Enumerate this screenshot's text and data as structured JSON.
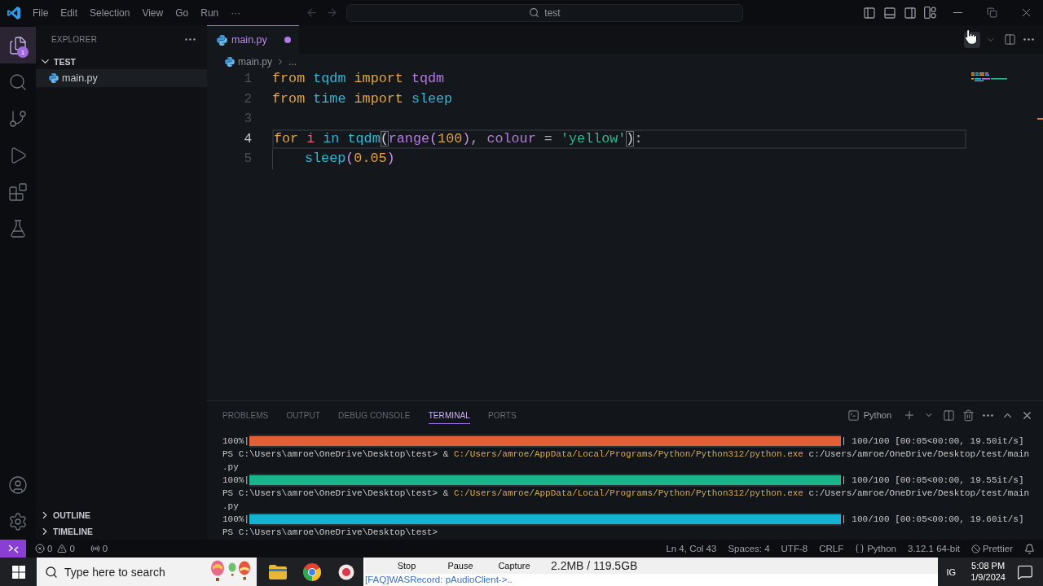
{
  "title_bar": {
    "menu": [
      "File",
      "Edit",
      "Selection",
      "View",
      "Go",
      "Run",
      "···"
    ],
    "command_center": "test"
  },
  "activity_bar": {
    "items": [
      {
        "kind": "explorer",
        "selected": true,
        "badge": "1"
      },
      {
        "kind": "search",
        "selected": false
      },
      {
        "kind": "source-control",
        "selected": false
      },
      {
        "kind": "run",
        "selected": false
      },
      {
        "kind": "extensions",
        "selected": false
      },
      {
        "kind": "testing",
        "selected": false
      }
    ],
    "bottom": [
      {
        "kind": "account"
      },
      {
        "kind": "settings"
      }
    ]
  },
  "sidebar": {
    "title": "EXPLORER",
    "folder": {
      "name": "TEST",
      "expanded": true,
      "children": [
        {
          "name": "main.py",
          "selected": true
        }
      ]
    },
    "sections": [
      {
        "name": "OUTLINE",
        "expanded": false
      },
      {
        "name": "TIMELINE",
        "expanded": false
      }
    ]
  },
  "editor": {
    "tabs": [
      {
        "label": "main.py",
        "selected": true,
        "modified": true
      }
    ],
    "breadcrumb": [
      "main.py",
      "..."
    ],
    "lines": [
      {
        "number": "1",
        "current": false,
        "tokens": [
          {
            "kind": "keyword",
            "text": "from"
          },
          {
            "kind": "module",
            "text": " tqdm"
          },
          {
            "kind": "keyword",
            "text": " import"
          },
          {
            "kind": "name",
            "text": " tqdm"
          }
        ]
      },
      {
        "number": "2",
        "current": false,
        "tokens": [
          {
            "kind": "keyword",
            "text": "from"
          },
          {
            "kind": "module",
            "text": " time"
          },
          {
            "kind": "keyword",
            "text": " import"
          },
          {
            "kind": "function",
            "text": " sleep"
          }
        ]
      },
      {
        "number": "3",
        "current": false
      },
      {
        "number": "4",
        "current": true,
        "tokens": [
          {
            "kind": "keyword",
            "text": "for"
          },
          {
            "kind": "variable",
            "text": " i"
          },
          {
            "kind": "operator",
            "text": " in"
          },
          {
            "kind": "function",
            "text": " tqdm"
          },
          {
            "kind": "bracket-match",
            "text": "("
          },
          {
            "kind": "builtin",
            "text": "range"
          },
          {
            "kind": "paren",
            "text": "("
          },
          {
            "kind": "number",
            "text": "100"
          },
          {
            "kind": "paren",
            "text": ")"
          },
          {
            "kind": "punct",
            "text": ","
          },
          {
            "kind": "param",
            "text": " colour"
          },
          {
            "kind": "punct",
            "text": " ="
          },
          {
            "kind": "string",
            "text": " 'yellow'"
          },
          {
            "kind": "bracket-match",
            "text": ")"
          },
          {
            "kind": "punct",
            "text": ":"
          }
        ],
        "children": [
          {
            "number": "5",
            "current": false,
            "tokens": [
              {
                "kind": "function",
                "text": "sleep"
              },
              {
                "kind": "paren",
                "text": "("
              },
              {
                "kind": "number",
                "text": "0.05"
              },
              {
                "kind": "paren",
                "text": ")"
              }
            ]
          }
        ]
      }
    ]
  },
  "panel": {
    "tabs": [
      {
        "label": "PROBLEMS",
        "selected": false
      },
      {
        "label": "OUTPUT",
        "selected": false
      },
      {
        "label": "DEBUG CONSOLE",
        "selected": false
      },
      {
        "label": "TERMINAL",
        "selected": true
      },
      {
        "label": "PORTS",
        "selected": false
      }
    ],
    "terminal": {
      "profile": "Python",
      "lines": [
        {
          "kind": "progress",
          "percent": "100%|",
          "level": 1,
          "color": "#e35f36",
          "stats": "| 100/100 [00:05<00:00, 19.50it/s]"
        },
        {
          "kind": "command",
          "prompt": "PS C:\\Users\\amroe\\OneDrive\\Desktop\\test>",
          "operator": "&",
          "program": "C:/Users/amroe/AppData/Local/Programs/Python/Python312/python.exe",
          "argument": "c:/Users/amroe/OneDrive/Desktop/test/main"
        },
        {
          "kind": "output",
          "text": ".py"
        },
        {
          "kind": "progress",
          "percent": "100%|",
          "level": 1,
          "color": "#19b487",
          "stats": "| 100/100 [00:05<00:00, 19.55it/s]"
        },
        {
          "kind": "command",
          "prompt": "PS C:\\Users\\amroe\\OneDrive\\Desktop\\test>",
          "operator": "&",
          "program": "C:/Users/amroe/AppData/Local/Programs/Python/Python312/python.exe",
          "argument": "c:/Users/amroe/OneDrive/Desktop/test/main"
        },
        {
          "kind": "output",
          "text": ".py"
        },
        {
          "kind": "progress",
          "percent": "100%|",
          "level": 1,
          "color": "#14b3d1",
          "stats": "| 100/100 [00:05<00:00, 19.60it/s]"
        },
        {
          "kind": "prompt",
          "prompt": "PS C:\\Users\\amroe\\OneDrive\\Desktop\\test>"
        }
      ]
    }
  },
  "status_bar": {
    "errors": "0",
    "warnings": "0",
    "ports": "0",
    "items": [
      {
        "kind": "text",
        "text": "Ln 4, Col 43"
      },
      {
        "kind": "text",
        "text": "Spaces: 4"
      },
      {
        "kind": "text",
        "text": "UTF-8"
      },
      {
        "kind": "text",
        "text": "CRLF"
      },
      {
        "kind": "language",
        "text": "Python"
      },
      {
        "kind": "text",
        "text": "3.12.1 64-bit"
      },
      {
        "kind": "formatter",
        "text": "Prettier"
      }
    ]
  },
  "taskbar": {
    "search": {
      "placeholder": "Type here to search"
    },
    "apps": [
      {
        "kind": "folder"
      },
      {
        "kind": "browser"
      },
      {
        "kind": "round-app"
      }
    ],
    "recorder_window": {
      "buttons": [
        "Stop",
        "Pause",
        "Capture"
      ],
      "stats": "2.2MB / 119.5GB",
      "log": "[FAQ]WASRecord: pAudioClient->.."
    },
    "tray": {
      "language": "IG",
      "time": "5:08 PM",
      "date": "1/9/2024"
    }
  }
}
